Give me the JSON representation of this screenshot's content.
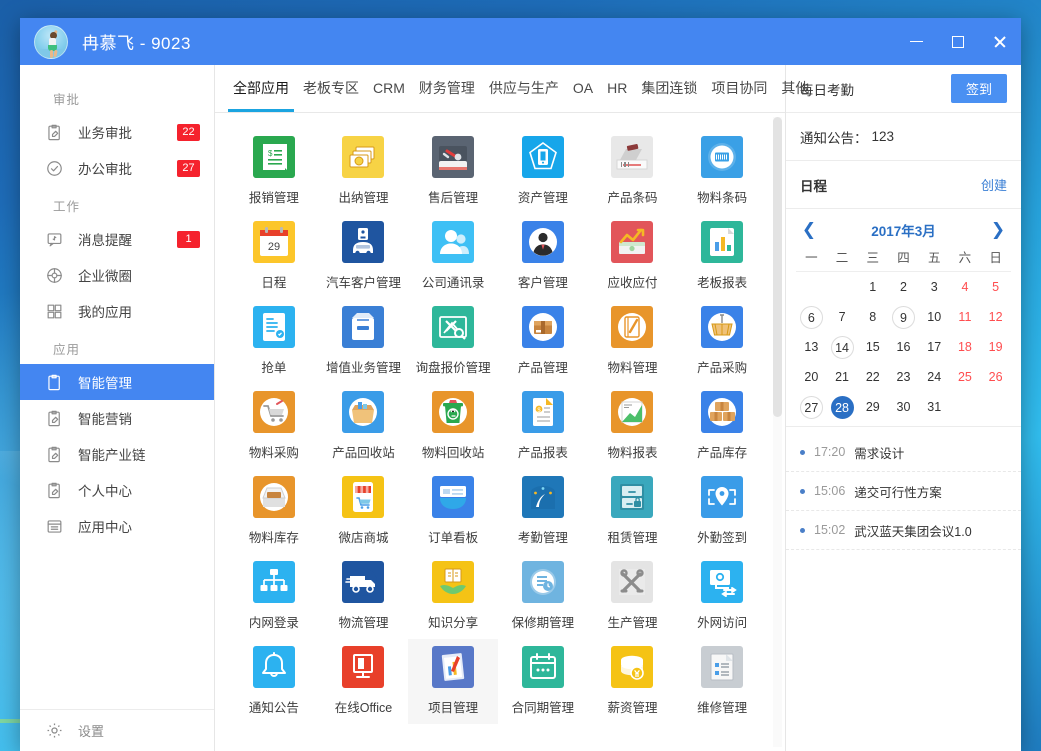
{
  "window": {
    "title": "冉慕飞 - 9023",
    "avatar_name": "user-avatar",
    "minimize_label": "",
    "maximize_label": "",
    "close_label": ""
  },
  "sidebar": {
    "groups": [
      {
        "title": "审批",
        "items": [
          {
            "label": "业务审批",
            "icon": "clipboard-edit-icon",
            "badge": "22",
            "active": false
          },
          {
            "label": "办公审批",
            "icon": "check-circle-icon",
            "badge": "27",
            "active": false
          }
        ]
      },
      {
        "title": "工作",
        "items": [
          {
            "label": "消息提醒",
            "icon": "message-bell-icon",
            "badge": "1",
            "active": false
          },
          {
            "label": "企业微圈",
            "icon": "circle-globe-icon",
            "badge": "",
            "active": false
          },
          {
            "label": "我的应用",
            "icon": "grid-apps-icon",
            "badge": "",
            "active": false
          }
        ]
      },
      {
        "title": "应用",
        "items": [
          {
            "label": "智能管理",
            "icon": "clipboard-icon",
            "badge": "",
            "active": true
          },
          {
            "label": "智能营销",
            "icon": "clipboard-edit-icon",
            "badge": "",
            "active": false
          },
          {
            "label": "智能产业链",
            "icon": "clipboard-edit-icon",
            "badge": "",
            "active": false
          },
          {
            "label": "个人中心",
            "icon": "clipboard-edit-icon",
            "badge": "",
            "active": false
          },
          {
            "label": "应用中心",
            "icon": "archive-box-icon",
            "badge": "",
            "active": false
          }
        ]
      }
    ],
    "settings": {
      "label": "设置",
      "icon": "gear-icon"
    }
  },
  "main": {
    "tabs": [
      {
        "label": "全部应用",
        "active": true
      },
      {
        "label": "老板专区",
        "active": false
      },
      {
        "label": "CRM",
        "active": false
      },
      {
        "label": "财务管理",
        "active": false
      },
      {
        "label": "供应与生产",
        "active": false
      },
      {
        "label": "OA",
        "active": false
      },
      {
        "label": "HR",
        "active": false
      },
      {
        "label": "集团连锁",
        "active": false
      },
      {
        "label": "项目协同",
        "active": false
      },
      {
        "label": "其他",
        "active": false
      }
    ],
    "apps": [
      {
        "label": "报销管理",
        "icon": "receipt-dollar-icon",
        "bg": "#2aa84f",
        "fg": "#ffffff"
      },
      {
        "label": "出纳管理",
        "icon": "cash-stack-icon",
        "bg": "#f7d345",
        "fg": "#d79a17"
      },
      {
        "label": "售后管理",
        "icon": "toolbox-wrench-icon",
        "bg": "#5a6472",
        "fg": "#ffffff"
      },
      {
        "label": "资产管理",
        "icon": "asset-shield-icon",
        "bg": "#17a6ea",
        "fg": "#ffffff"
      },
      {
        "label": "产品条码",
        "icon": "barcode-scanner-icon",
        "bg": "#e8e8e8",
        "fg": "#7c7c7c"
      },
      {
        "label": "物料条码",
        "icon": "barcode-round-icon",
        "bg": "#3aa0e6",
        "fg": "#ffffff"
      },
      {
        "label": "日程",
        "icon": "calendar-29-icon",
        "bg": "#fcc62a",
        "fg": "#ffffff"
      },
      {
        "label": "汽车客户管理",
        "icon": "car-customer-icon",
        "bg": "#1f55a0",
        "fg": "#ffffff"
      },
      {
        "label": "公司通讯录",
        "icon": "contacts-icon",
        "bg": "#3ec0f5",
        "fg": "#ffffff"
      },
      {
        "label": "客户管理",
        "icon": "customer-person-icon",
        "bg": "#3a82e8",
        "fg": "#ffffff"
      },
      {
        "label": "应收应付",
        "icon": "chart-money-icon",
        "bg": "#e2555a",
        "fg": "#ffffff"
      },
      {
        "label": "老板报表",
        "icon": "bar-report-icon",
        "bg": "#2eb79a",
        "fg": "#ffffff"
      },
      {
        "label": "抢单",
        "icon": "order-list-icon",
        "bg": "#2cb2f0",
        "fg": "#ffffff"
      },
      {
        "label": "增值业务管理",
        "icon": "file-box-icon",
        "bg": "#3a7fd5",
        "fg": "#ffffff"
      },
      {
        "label": "询盘报价管理",
        "icon": "inquiry-search-icon",
        "bg": "#2eb79a",
        "fg": "#ffffff"
      },
      {
        "label": "产品管理",
        "icon": "product-box-icon",
        "bg": "#3a82e8",
        "fg": "#ffffff"
      },
      {
        "label": "物料管理",
        "icon": "notebook-pen-icon",
        "bg": "#e8952b",
        "fg": "#ffffff"
      },
      {
        "label": "产品采购",
        "icon": "basket-icon",
        "bg": "#3a82e8",
        "fg": "#ffffff"
      },
      {
        "label": "物料采购",
        "icon": "cart-icon",
        "bg": "#e8952b",
        "fg": "#ffffff"
      },
      {
        "label": "产品回收站",
        "icon": "recycle-box-icon",
        "bg": "#3a9ce8",
        "fg": "#ffffff"
      },
      {
        "label": "物料回收站",
        "icon": "trash-recycle-icon",
        "bg": "#e8952b",
        "fg": "#ffffff"
      },
      {
        "label": "产品报表",
        "icon": "invoice-icon",
        "bg": "#3a9ce8",
        "fg": "#ffffff"
      },
      {
        "label": "物料报表",
        "icon": "growth-chart-icon",
        "bg": "#e8952b",
        "fg": "#ffffff"
      },
      {
        "label": "产品库存",
        "icon": "boxes-stack-icon",
        "bg": "#3a82e8",
        "fg": "#ffffff"
      },
      {
        "label": "物料库存",
        "icon": "inbox-archive-icon",
        "bg": "#e8952b",
        "fg": "#ffffff"
      },
      {
        "label": "微店商城",
        "icon": "mobile-shop-icon",
        "bg": "#f5c315",
        "fg": "#ffffff"
      },
      {
        "label": "订单看板",
        "icon": "dashboard-board-icon",
        "bg": "#3a82e8",
        "fg": "#ffffff"
      },
      {
        "label": "考勤管理",
        "icon": "attendance-icon",
        "bg": "#1f77b8",
        "fg": "#ffffff"
      },
      {
        "label": "租赁管理",
        "icon": "cabinet-lock-icon",
        "bg": "#3aa8bd",
        "fg": "#ffffff"
      },
      {
        "label": "外勤签到",
        "icon": "location-pin-icon",
        "bg": "#3a9ce8",
        "fg": "#ffffff"
      },
      {
        "label": "内网登录",
        "icon": "network-tree-icon",
        "bg": "#2cb2f0",
        "fg": "#ffffff"
      },
      {
        "label": "物流管理",
        "icon": "truck-icon",
        "bg": "#1f55a0",
        "fg": "#ffffff"
      },
      {
        "label": "知识分享",
        "icon": "book-hand-icon",
        "bg": "#f5c315",
        "fg": "#ffffff"
      },
      {
        "label": "保修期管理",
        "icon": "warranty-clock-icon",
        "bg": "#6fb4e0",
        "fg": "#ffffff"
      },
      {
        "label": "生产管理",
        "icon": "tools-cross-icon",
        "bg": "#e4e4e4",
        "fg": "#7c7c7c"
      },
      {
        "label": "外网访问",
        "icon": "remote-screen-icon",
        "bg": "#2cb2f0",
        "fg": "#ffffff"
      },
      {
        "label": "通知公告",
        "icon": "bell-icon",
        "bg": "#2cb2f0",
        "fg": "#ffffff"
      },
      {
        "label": "在线Office",
        "icon": "office-icon",
        "bg": "#e8402a",
        "fg": "#ffffff"
      },
      {
        "label": "项目管理",
        "icon": "project-chart-icon",
        "bg": "#5878c8",
        "fg": "#ffffff"
      },
      {
        "label": "合同期管理",
        "icon": "calendar-plain-icon",
        "bg": "#2eb79a",
        "fg": "#ffffff"
      },
      {
        "label": "薪资管理",
        "icon": "coins-yen-icon",
        "bg": "#f5c315",
        "fg": "#ffffff"
      },
      {
        "label": "维修管理",
        "icon": "doc-list-icon",
        "bg": "#c8cdd2",
        "fg": "#ffffff"
      }
    ],
    "hovered_app_index": 38
  },
  "right_panel": {
    "attendance": {
      "title": "每日考勤",
      "button": "签到"
    },
    "notice": {
      "label": "通知公告：",
      "value": "123"
    },
    "schedule_header": {
      "title": "日程",
      "create": "创建"
    },
    "calendar": {
      "month_label": "2017年3月",
      "prev_icon": "chevron-left-icon",
      "next_icon": "chevron-right-icon",
      "dow": [
        "一",
        "二",
        "三",
        "四",
        "五",
        "六",
        "日"
      ],
      "lead_blanks": 2,
      "days": [
        {
          "n": "1"
        },
        {
          "n": "2"
        },
        {
          "n": "3"
        },
        {
          "n": "4",
          "weekend": true
        },
        {
          "n": "5",
          "weekend": true
        },
        {
          "n": "6",
          "marked": true
        },
        {
          "n": "7"
        },
        {
          "n": "8"
        },
        {
          "n": "9",
          "marked": true
        },
        {
          "n": "10"
        },
        {
          "n": "11",
          "weekend": true
        },
        {
          "n": "12",
          "weekend": true
        },
        {
          "n": "13"
        },
        {
          "n": "14",
          "marked": true
        },
        {
          "n": "15"
        },
        {
          "n": "16"
        },
        {
          "n": "17"
        },
        {
          "n": "18",
          "weekend": true
        },
        {
          "n": "19",
          "weekend": true
        },
        {
          "n": "20"
        },
        {
          "n": "21"
        },
        {
          "n": "22"
        },
        {
          "n": "23"
        },
        {
          "n": "24"
        },
        {
          "n": "25",
          "weekend": true
        },
        {
          "n": "26",
          "weekend": true
        },
        {
          "n": "27",
          "marked": true
        },
        {
          "n": "28",
          "today": true
        },
        {
          "n": "29"
        },
        {
          "n": "30"
        },
        {
          "n": "31"
        }
      ]
    },
    "schedule_items": [
      {
        "time": "17:20",
        "text": "需求设计"
      },
      {
        "time": "15:06",
        "text": "递交可行性方案"
      },
      {
        "time": "15:02",
        "text": "武汉蓝天集团会议1.0"
      }
    ]
  },
  "colors": {
    "accent": "#4486f1",
    "tab_underline": "#1ba4e0",
    "badge_red": "#f5222d",
    "calendar_blue": "#2a6fc4",
    "weekend_red": "#ff4d4f"
  }
}
